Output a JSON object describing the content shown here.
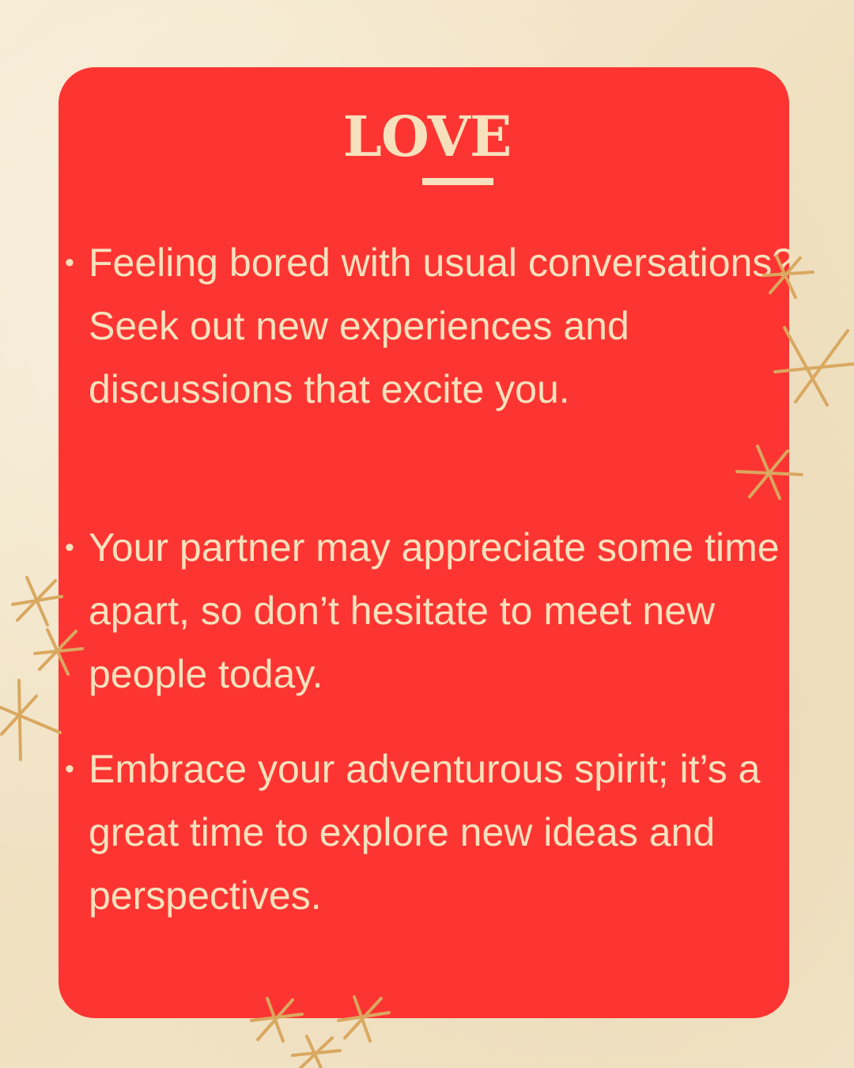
{
  "title": "Love",
  "bullets": [
    "Feeling bored with usual conversations? Seek out new experiences and discussions that excite you.",
    "Your partner may appreciate some time apart, so don’t hesitate to meet new people today.",
    "Embrace your adventurous spirit; it’s a great time to explore new ideas and perspectives."
  ],
  "colors": {
    "background": "#f4e6c8",
    "card": "#fd3532",
    "text": "#f7e1bd",
    "stars": "#d9a860"
  },
  "decorations": {
    "bullet_glyph": "•",
    "icon": "sparkle-star-icon"
  }
}
